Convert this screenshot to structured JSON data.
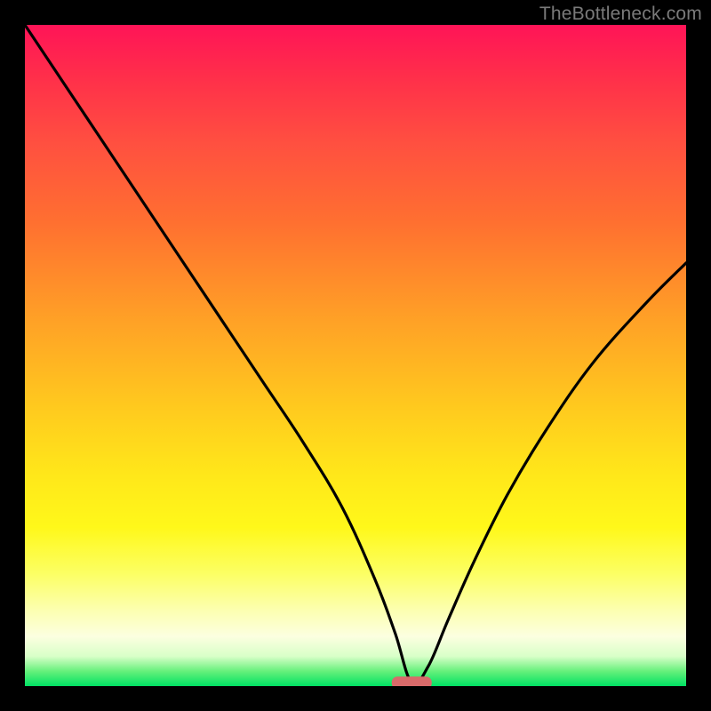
{
  "watermark": "TheBottleneck.com",
  "chart_data": {
    "type": "line",
    "title": "",
    "xlabel": "",
    "ylabel": "",
    "xlim": [
      0,
      100
    ],
    "ylim": [
      0,
      100
    ],
    "grid": false,
    "legend": false,
    "gradient_colors_top_to_bottom": [
      "#ff1457",
      "#ff5040",
      "#ffa226",
      "#ffe71a",
      "#fcffb0",
      "#63f07a",
      "#00e264"
    ],
    "series": [
      {
        "name": "bottleneck-curve",
        "color": "#000000",
        "x": [
          0,
          6,
          12,
          18,
          24,
          30,
          36,
          42,
          48,
          53,
          56,
          58.5,
          61,
          64,
          68,
          73,
          79,
          86,
          94,
          100
        ],
        "y": [
          100,
          91,
          82,
          73,
          64,
          55,
          46,
          37,
          27,
          16,
          8,
          0.5,
          3,
          10,
          19,
          29,
          39,
          49,
          58,
          64
        ]
      }
    ],
    "marker": {
      "name": "optimal-point",
      "shape": "rounded-capsule",
      "x": 58.5,
      "y": 0.5,
      "color": "#d96a6a"
    }
  }
}
